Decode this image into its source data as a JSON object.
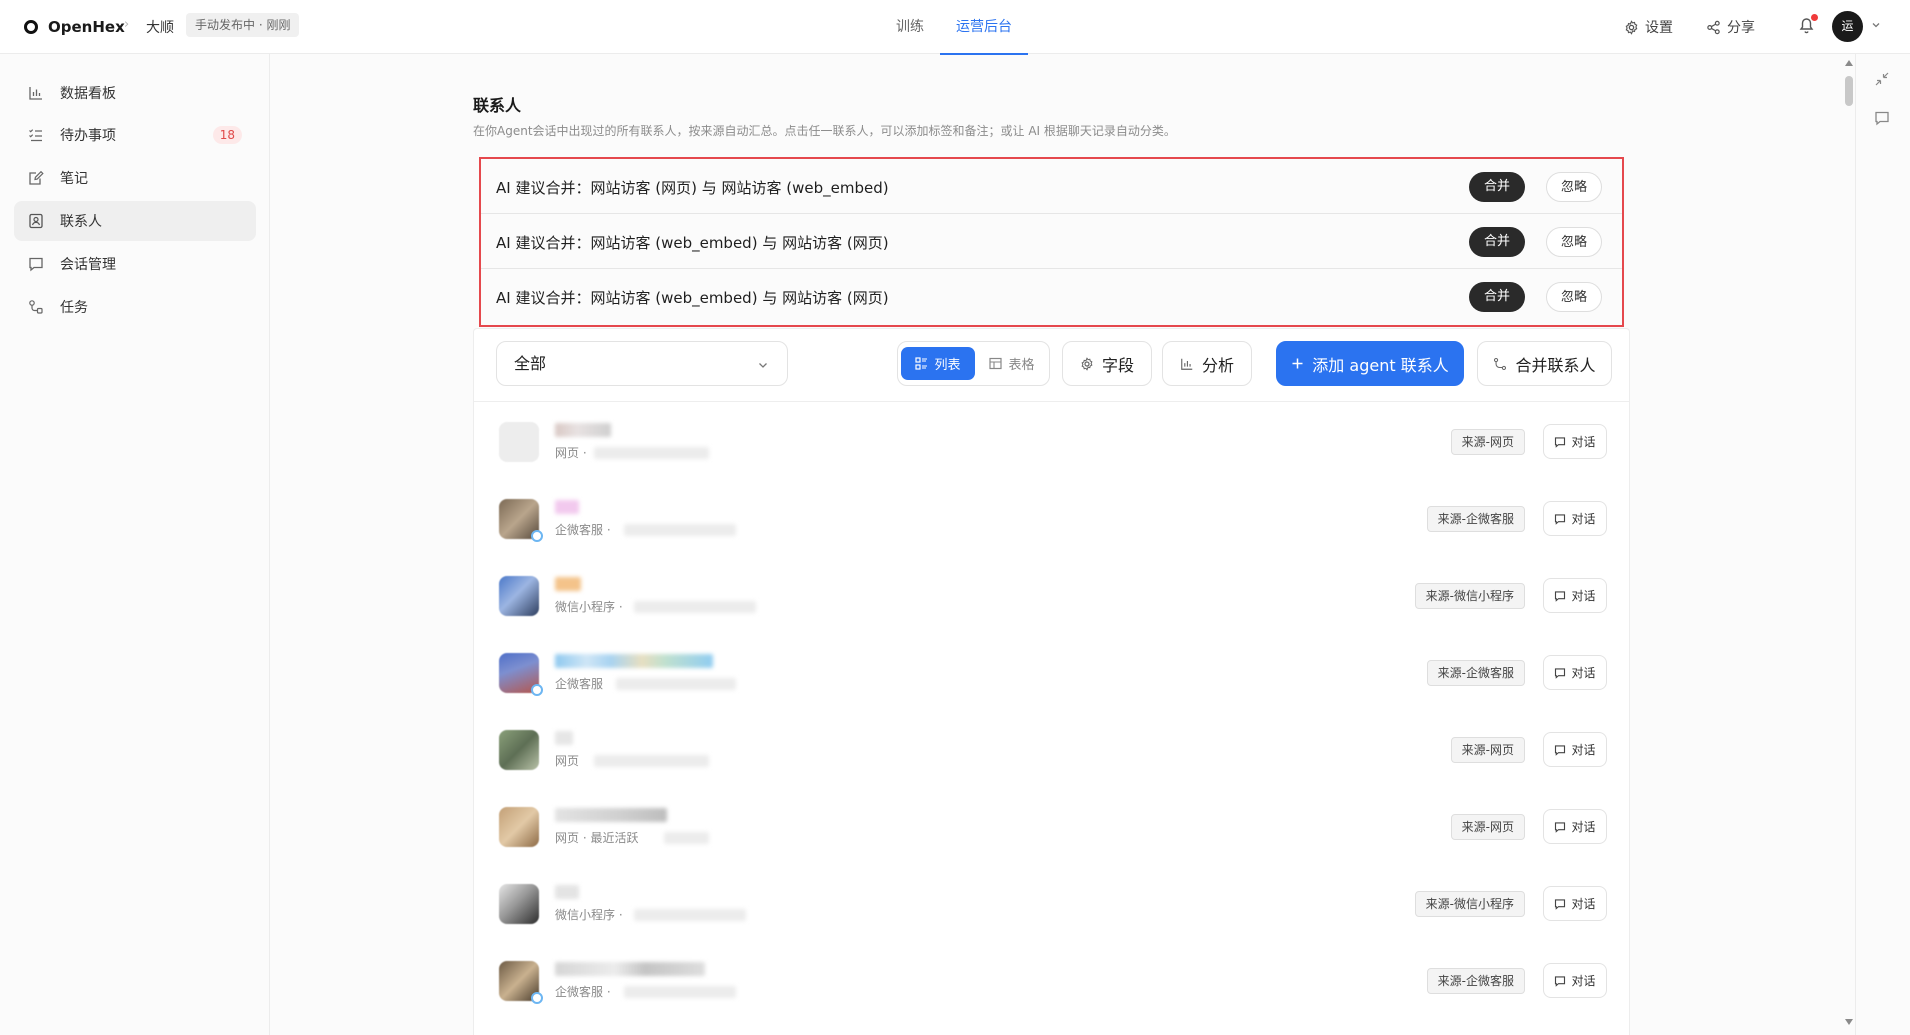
{
  "header": {
    "brand": "OpenHex",
    "breadcrumb_sep": "›",
    "agent_name": "大顺",
    "status": "手动发布中 · 刚刚",
    "nav": [
      {
        "label": "训练",
        "active": false
      },
      {
        "label": "运营后台",
        "active": true
      }
    ],
    "settings_label": "设置",
    "share_label": "分享",
    "avatar_text": "运"
  },
  "sidebar": {
    "items": [
      {
        "label": "数据看板",
        "icon": "chart-icon"
      },
      {
        "label": "待办事项",
        "icon": "checklist-icon",
        "badge": "18"
      },
      {
        "label": "笔记",
        "icon": "note-edit-icon"
      },
      {
        "label": "联系人",
        "icon": "contact-icon",
        "active": true
      },
      {
        "label": "会话管理",
        "icon": "chat-bubble-icon"
      },
      {
        "label": "任务",
        "icon": "task-flow-icon"
      }
    ]
  },
  "page": {
    "title": "联系人",
    "description": "在你Agent会话中出现过的所有联系人，按来源自动汇总。点击任一联系人，可以添加标签和备注；或让 AI 根据聊天记录自动分类。"
  },
  "suggestions": [
    {
      "text": "AI 建议合并：网站访客 (网页) 与 网站访客 (web_embed)",
      "merge_label": "合并",
      "ignore_label": "忽略"
    },
    {
      "text": "AI 建议合并：网站访客 (web_embed) 与 网站访客 (网页)",
      "merge_label": "合并",
      "ignore_label": "忽略"
    },
    {
      "text": "AI 建议合并：网站访客 (web_embed) 与 网站访客 (网页)",
      "merge_label": "合并",
      "ignore_label": "忽略"
    }
  ],
  "toolbar": {
    "filter_value": "全部",
    "view_list_label": "列表",
    "view_table_label": "表格",
    "fields_label": "字段",
    "analyze_label": "分析",
    "add_label": "添加 agent 联系人",
    "merge_contacts_label": "合并联系人"
  },
  "contacts": [
    {
      "meta": "网页 ·",
      "source": "来源-网页",
      "chat": "对话"
    },
    {
      "meta": "企微客服 ·",
      "source": "来源-企微客服",
      "chat": "对话"
    },
    {
      "meta": "微信小程序 ·",
      "source": "来源-微信小程序",
      "chat": "对话"
    },
    {
      "meta": "企微客服",
      "source": "来源-企微客服",
      "chat": "对话"
    },
    {
      "meta": "网页",
      "source": "来源-网页",
      "chat": "对话"
    },
    {
      "meta": "网页 · 最近活跃",
      "source": "来源-网页",
      "chat": "对话"
    },
    {
      "meta": "微信小程序 ·",
      "source": "来源-微信小程序",
      "chat": "对话"
    },
    {
      "meta": "企微客服 ·",
      "source": "来源-企微客服",
      "chat": "对话"
    }
  ],
  "colors": {
    "accent": "#2b73f0",
    "highlight_border": "#e5484d",
    "badge_bg": "#fde9e9",
    "badge_text": "#e04a4a"
  }
}
